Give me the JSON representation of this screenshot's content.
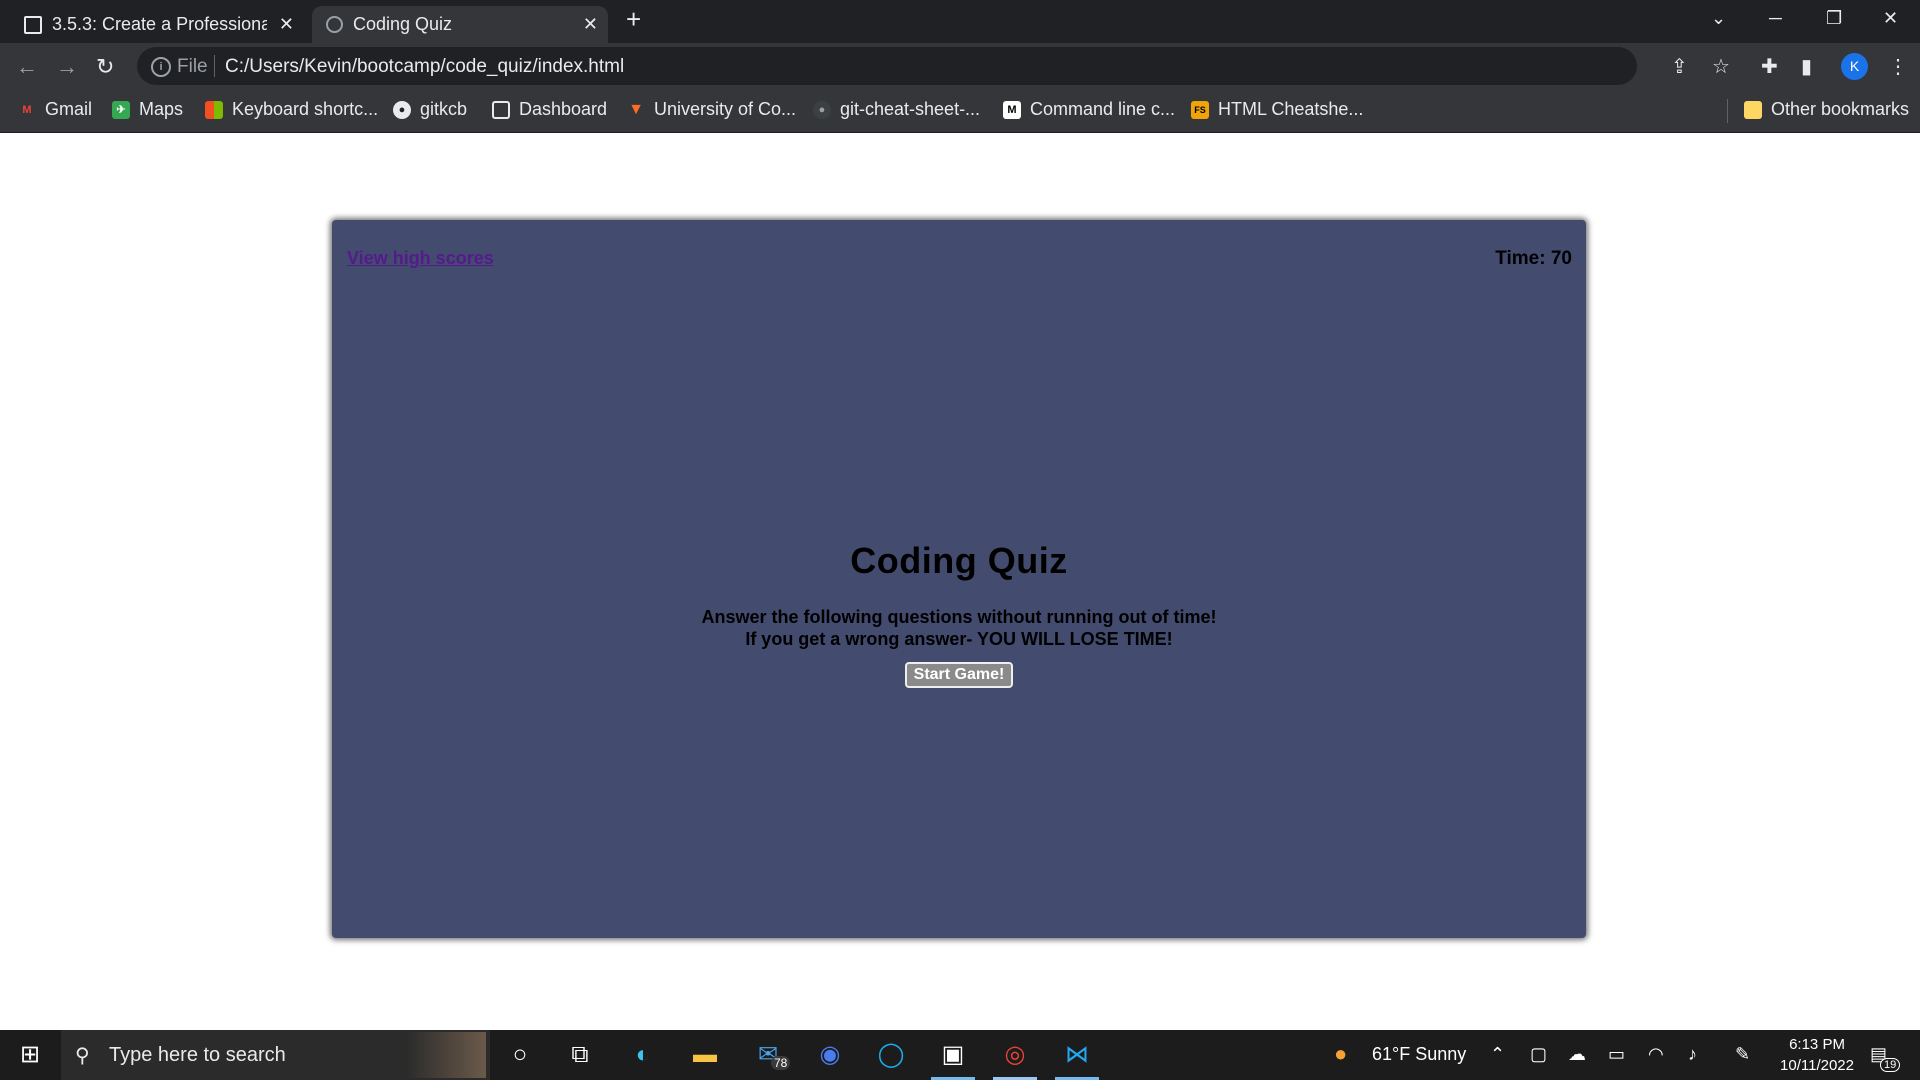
{
  "browser": {
    "tabs": [
      {
        "title": "3.5.3: Create a Professional F",
        "active": false
      },
      {
        "title": "Coding Quiz",
        "active": true
      }
    ],
    "new_tab": "+",
    "address": {
      "scheme_label": "File",
      "url": "C:/Users/Kevin/bootcamp/code_quiz/index.html"
    },
    "profile_initial": "K",
    "bookmarks": [
      "Gmail",
      "Maps",
      "Keyboard shortc...",
      "gitkcb",
      "Dashboard",
      "University of Co...",
      "git-cheat-sheet-...",
      "Command line c...",
      "HTML Cheatshe..."
    ],
    "other_bookmarks": "Other bookmarks"
  },
  "quiz": {
    "high_scores_link": "View high scores",
    "timer": "Time: 70",
    "title": "Coding Quiz",
    "instructions_line1": "Answer the following questions without running out of time!",
    "instructions_line2": "If you get a wrong answer- YOU WILL LOSE TIME!",
    "start_button": "Start Game!"
  },
  "taskbar": {
    "search_placeholder": "Type here to search",
    "mail_badge": "78",
    "weather": "61°F  Sunny",
    "time": "6:13 PM",
    "date": "10/11/2022",
    "notification_count": "19"
  },
  "colors": {
    "quiz_background": "#434b6f",
    "link": "#551a8b",
    "accent": "#1a73e8"
  }
}
